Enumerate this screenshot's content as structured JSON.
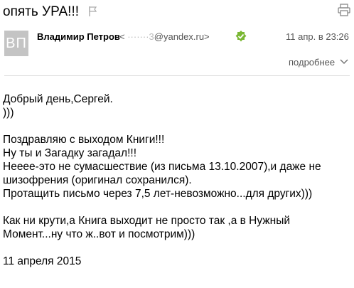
{
  "header": {
    "subject": "опять УРА!!!",
    "icons": {
      "flag": "flag-icon",
      "print": "print-icon"
    }
  },
  "sender": {
    "avatar_initials": "ВП",
    "name": "Владимир Петров",
    "email_open": "<",
    "email_hidden": "·······3",
    "email_domain": "@yandex.ru>",
    "verified_icon": "verified-check-icon",
    "date": "11 апр. в 23:26"
  },
  "details": {
    "label": "подробнее",
    "icon": "chevron-down-icon"
  },
  "colors": {
    "verified": "#7ab733",
    "muted": "#555555",
    "avatar": "#c4c4c4"
  },
  "message": {
    "greeting": " Добрый день,Сергей.",
    "smile": " )))",
    "p1_l1": "Поздравляю с выходом Книги!!!",
    "p1_l2": "Ну ты и Загадку загадал!!!",
    "p1_l3": "Нееее-это не сумасшествие (из письма 13.10.2007),и даже не",
    "p1_l4": "шизофрения (оригинал сохранился).",
    "p1_l5": "Протащить письмо через 7,5 лет-невозможно...для других)))",
    "p2_l1": "Как ни крути,а Книга выходит не просто так ,а в Нужный",
    "p2_l2": "Момент...ну что ж..вот и посмотрим)))",
    "signature_date": "11 апреля 2015"
  }
}
